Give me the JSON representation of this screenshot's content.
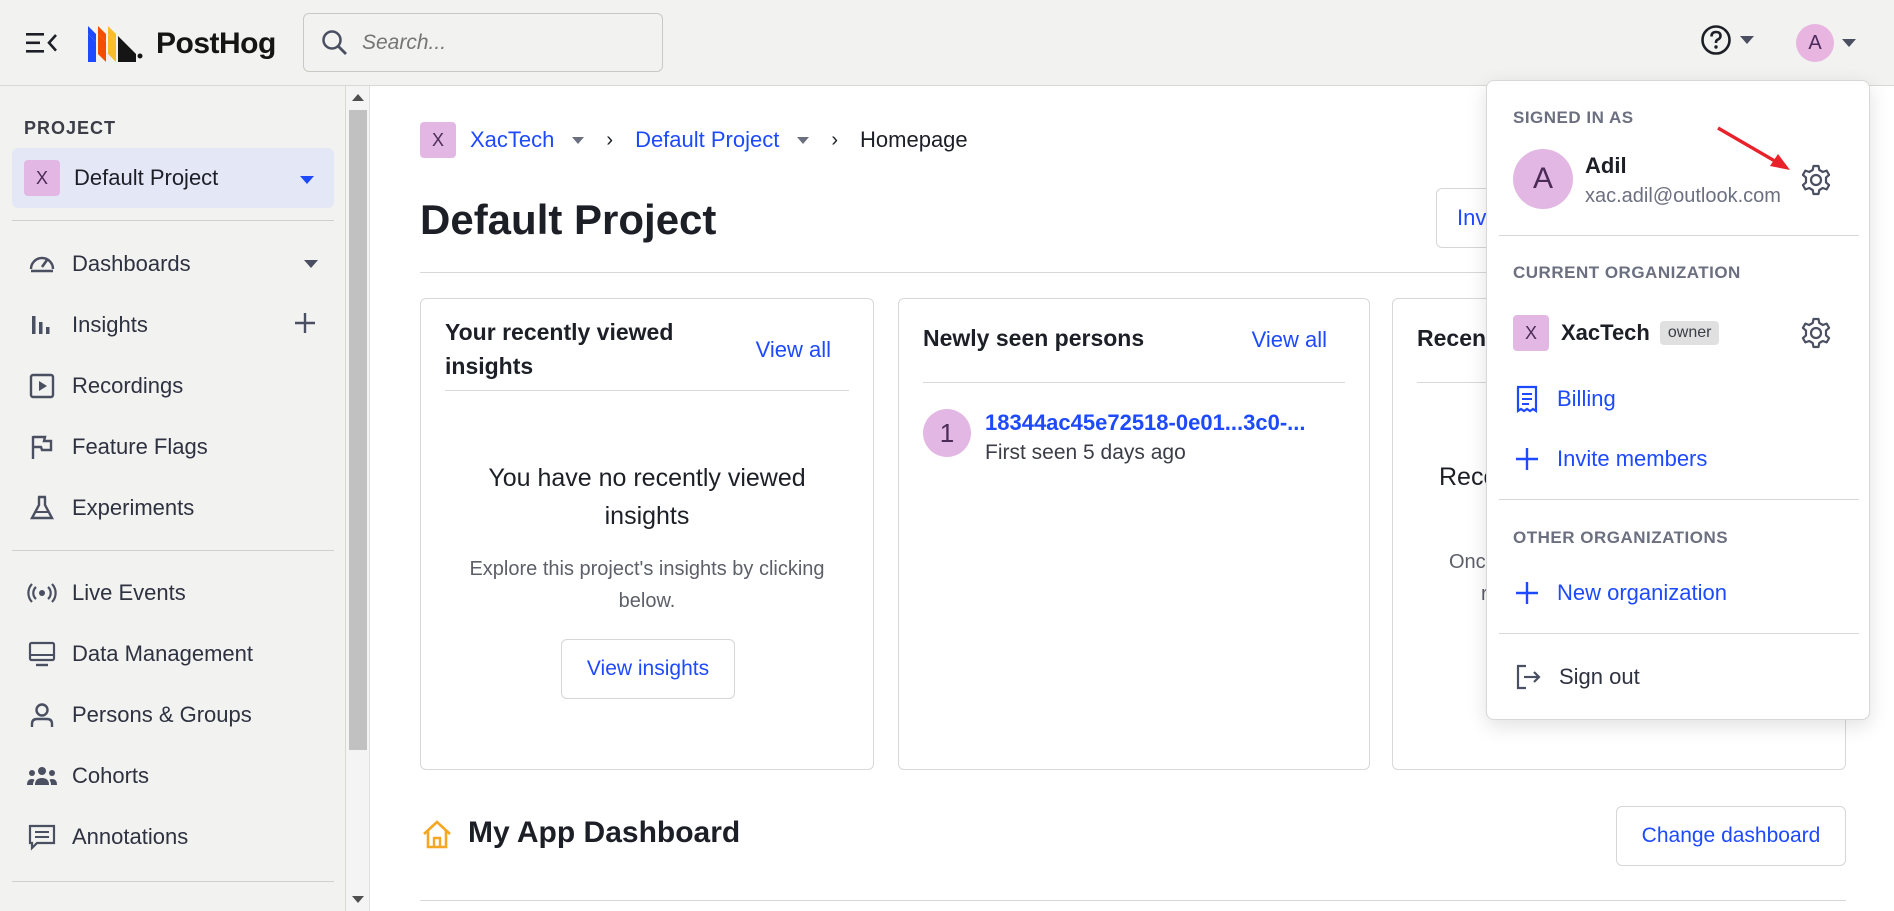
{
  "app": {
    "name": "PostHog"
  },
  "search": {
    "placeholder": "Search..."
  },
  "user_menu": {
    "avatar_initial": "A"
  },
  "sidebar": {
    "section_title": "PROJECT",
    "project": {
      "badge": "X",
      "name": "Default Project"
    },
    "items_group1": [
      {
        "label": "Dashboards",
        "icon": "dashboard-icon"
      },
      {
        "label": "Insights",
        "icon": "insights-icon"
      },
      {
        "label": "Recordings",
        "icon": "recordings-icon"
      },
      {
        "label": "Feature Flags",
        "icon": "flag-icon"
      },
      {
        "label": "Experiments",
        "icon": "flask-icon"
      }
    ],
    "items_group2": [
      {
        "label": "Live Events",
        "icon": "live-events-icon"
      },
      {
        "label": "Data Management",
        "icon": "monitor-icon"
      },
      {
        "label": "Persons & Groups",
        "icon": "person-icon"
      },
      {
        "label": "Cohorts",
        "icon": "cohorts-icon"
      },
      {
        "label": "Annotations",
        "icon": "annotation-icon"
      }
    ]
  },
  "breadcrumb": {
    "org_badge": "X",
    "org": "XacTech",
    "project": "Default Project",
    "current": "Homepage",
    "separator": "›"
  },
  "page": {
    "title": "Default Project",
    "invite_label": "Inv"
  },
  "cards": {
    "insights": {
      "title": "Your recently viewed insights",
      "view_all": "View all",
      "empty_title": "You have no recently viewed insights",
      "empty_desc": "Explore this project's insights by clicking below.",
      "button": "View insights"
    },
    "persons": {
      "title": "Newly seen persons",
      "view_all": "View all",
      "person": {
        "avatar": "1",
        "id": "18344ac45e72518-0e01...3c0-...",
        "seen": "First seen 5 days ago"
      }
    },
    "recordings": {
      "title": "Recen",
      "empty_title": "Reco",
      "empty_desc_1": "Onc",
      "empty_desc_2": "r"
    }
  },
  "dashboard": {
    "title": "My App Dashboard",
    "change_button": "Change dashboard"
  },
  "dropdown": {
    "signed_in_as": "SIGNED IN AS",
    "user": {
      "initial": "A",
      "name": "Adil",
      "email": "xac.adil@outlook.com"
    },
    "current_org_title": "CURRENT ORGANIZATION",
    "org": {
      "badge": "X",
      "name": "XacTech",
      "role": "owner"
    },
    "billing": "Billing",
    "invite_members": "Invite members",
    "other_orgs_title": "OTHER ORGANIZATIONS",
    "new_org": "New organization",
    "sign_out": "Sign out"
  },
  "colors": {
    "accent": "#1d4aff",
    "badge": "#e3b7e3",
    "annotation_arrow": "#e8212b"
  }
}
